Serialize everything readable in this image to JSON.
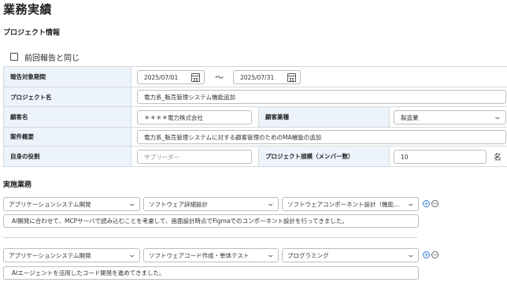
{
  "page": {
    "title": "業務実績"
  },
  "project_section": {
    "title": "プロジェクト情報",
    "same_as_previous_label": "前回報告と同じ",
    "period": {
      "label": "報告対象期間",
      "start": "2025/07/01",
      "separator": "〜",
      "end": "2025/07/31"
    },
    "project_name": {
      "label": "プロジェクト名",
      "value": "電力系_販売管理システム機能追加"
    },
    "client_name": {
      "label": "顧客名",
      "value": "＊＊＊＊電力株式会社"
    },
    "industry": {
      "label": "顧客業種",
      "value": "製造業"
    },
    "overview": {
      "label": "案件概要",
      "value": "電力系_販売管理システムに対する顧客管理のためのMA機能の追加"
    },
    "role": {
      "label": "自身の役割",
      "placeholder": "サブリーダー"
    },
    "scale": {
      "label": "プロジェクト規模（メンバー数）",
      "value": "10",
      "unit": "名"
    }
  },
  "tasks_section": {
    "title": "実施業務",
    "tasks": [
      {
        "category": "アプリケーションシステム開発",
        "phase": "ソフトウェア詳細設計",
        "detail": "ソフトウェアコンポーネント設計（機能…",
        "description": "AI開発に合わせて、MCPサーバで読み込むことを考慮して、画面設計時点でFigmaでのコンポーネント設計を行ってきました。",
        "add": "+",
        "remove": "−"
      },
      {
        "category": "アプリケーションシステム開発",
        "phase": "ソフトウェアコード作成・単体テスト",
        "detail": "プログラミング",
        "description": "AIエージェントを活用したコード開発を進めてきました。",
        "add": "+",
        "remove": "−"
      }
    ]
  },
  "colors": {
    "label_bg": "#edf3fb",
    "border": "#d4d8de",
    "accent": "#3b7dd8"
  },
  "icons": [
    "calendar-icon",
    "chevron-down-icon",
    "plus-circle-icon",
    "minus-circle-icon",
    "checkbox-icon"
  ]
}
